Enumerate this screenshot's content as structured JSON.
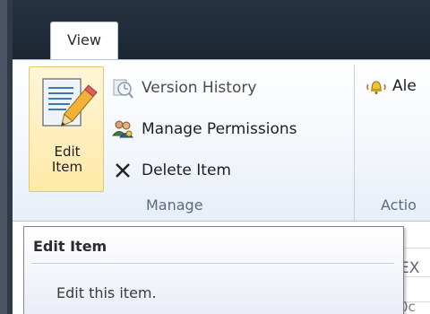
{
  "ribbon": {
    "active_tab": "View",
    "manage_group": {
      "label": "Manage",
      "edit_item": {
        "label": "Edit\nItem",
        "icon": "edit-document-icon"
      },
      "commands": [
        {
          "label": "Version History",
          "icon": "version-history-icon",
          "enabled": false
        },
        {
          "label": "Manage Permissions",
          "icon": "permissions-icon",
          "enabled": true
        },
        {
          "label": "Delete Item",
          "icon": "delete-x-icon",
          "enabled": true
        }
      ]
    },
    "actions_group": {
      "label": "Actio",
      "alert_me": {
        "label": "Ale",
        "icon": "alert-bell-icon"
      }
    }
  },
  "tooltip": {
    "title": "Edit Item",
    "body": "Edit this item."
  },
  "content": {
    "partial_text": "EX",
    "partial_text2": "0c"
  },
  "colors": {
    "highlight": "#ffe9a8",
    "header": "#1f2a38",
    "accent_tab_border": "#b6c3d3"
  }
}
